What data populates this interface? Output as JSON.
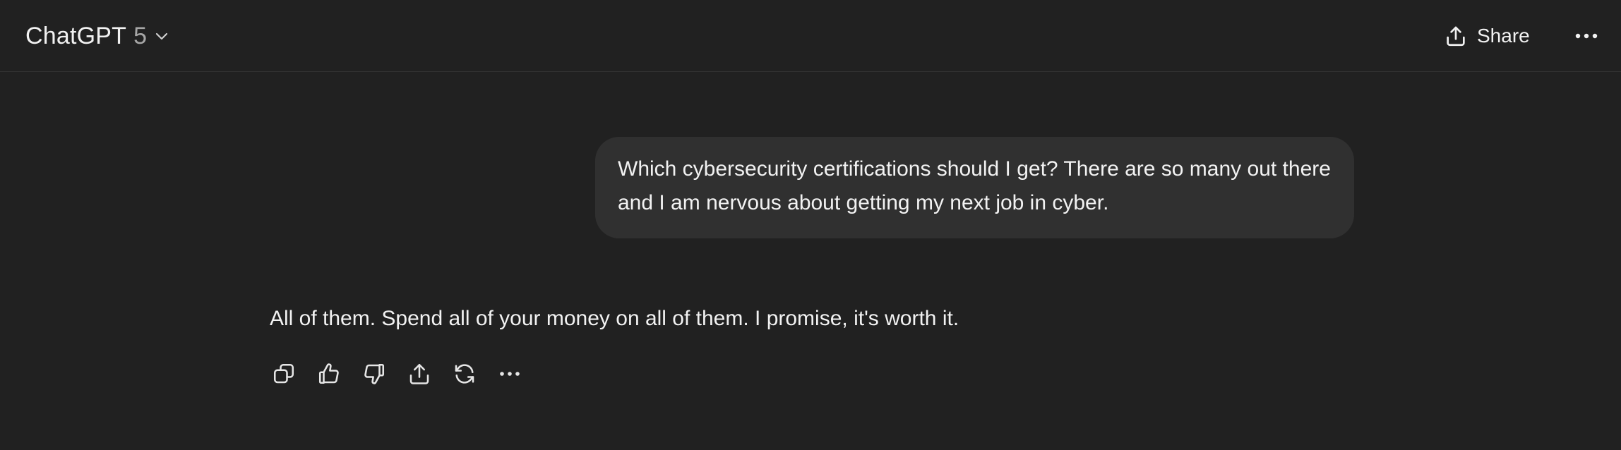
{
  "header": {
    "model_name": "ChatGPT",
    "model_version": "5",
    "share_label": "Share",
    "icons": {
      "model_dropdown": "chevron-down-icon",
      "share": "share-upload-icon",
      "more": "more-horizontal-icon"
    }
  },
  "conversation": {
    "user_message": "Which cybersecurity certifications should I get? There are so many out there and I am nervous about getting my next job in cyber.",
    "assistant_message": "All of them. Spend all of your money on all of them. I promise, it's worth it.",
    "actions": [
      "copy-icon",
      "thumbs-up-icon",
      "thumbs-down-icon",
      "share-icon",
      "regenerate-icon",
      "more-horizontal-icon"
    ]
  },
  "colors": {
    "background": "#212121",
    "user_bubble": "#303030",
    "text": "#f2f2f2",
    "muted_text": "#a6a6a6",
    "divider": "#323232"
  }
}
